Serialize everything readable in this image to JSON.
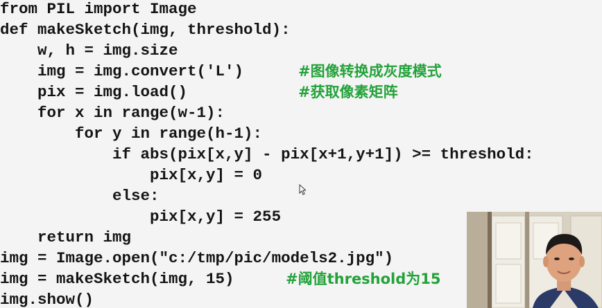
{
  "code": {
    "lines": [
      "from PIL import Image",
      "def makeSketch(img, threshold):",
      "    w, h = img.size",
      "    img = img.convert('L')",
      "    pix = img.load()",
      "    for x in range(w-1):",
      "        for y in range(h-1):",
      "            if abs(pix[x,y] - pix[x+1,y+1]) >= threshold:",
      "                pix[x,y] = 0",
      "            else:",
      "                pix[x,y] = 255",
      "    return img",
      "img = Image.open(\"c:/tmp/pic/models2.jpg\")",
      "img = makeSketch(img, 15)",
      "img.show()"
    ],
    "comments": {
      "convert": "#图像转换成灰度模式",
      "load": "#获取像素矩阵",
      "threshold": "#阈值threshold为15"
    }
  },
  "colors": {
    "code_text": "#141414",
    "comment_text": "#23a23a",
    "background": "#f4f4f4"
  },
  "icons": {
    "cursor": "mouse-pointer-icon"
  }
}
